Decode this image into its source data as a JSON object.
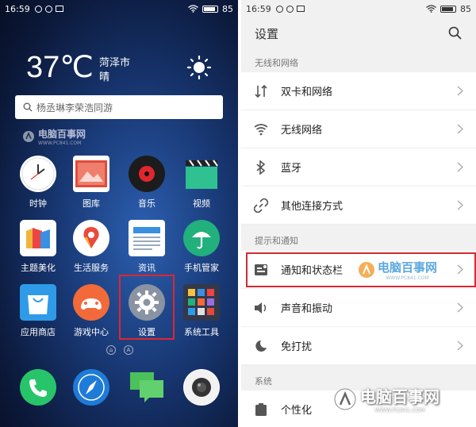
{
  "left": {
    "status": {
      "time": "16:59",
      "battery": "85"
    },
    "weather": {
      "temp": "37℃",
      "city": "菏泽市",
      "condition": "晴"
    },
    "search": {
      "hint": "杨丞琳李荣浩同游"
    },
    "watermark": {
      "title": "电脑百事网",
      "sub": "WWW.PC841.COM"
    },
    "apps": [
      {
        "label": "时钟",
        "icon": "clock-icon"
      },
      {
        "label": "图库",
        "icon": "gallery-icon"
      },
      {
        "label": "音乐",
        "icon": "music-icon"
      },
      {
        "label": "视频",
        "icon": "video-icon"
      },
      {
        "label": "主题美化",
        "icon": "theme-icon"
      },
      {
        "label": "生活服务",
        "icon": "life-service-icon"
      },
      {
        "label": "资讯",
        "icon": "news-icon"
      },
      {
        "label": "手机管家",
        "icon": "phone-manager-icon"
      },
      {
        "label": "应用商店",
        "icon": "app-store-icon"
      },
      {
        "label": "游戏中心",
        "icon": "game-center-icon"
      },
      {
        "label": "设置",
        "icon": "settings-icon"
      },
      {
        "label": "系统工具",
        "icon": "system-tools-icon"
      }
    ],
    "pager": {
      "page2": "A"
    },
    "dock": [
      "phone-icon",
      "browser-icon",
      "messages-icon",
      "camera-icon"
    ]
  },
  "right": {
    "status": {
      "time": "16:59",
      "battery": "85"
    },
    "header": {
      "title": "设置"
    },
    "sections": {
      "wireless": "无线和网络",
      "notify": "提示和通知",
      "system": "系统"
    },
    "items": [
      {
        "label": "双卡和网络",
        "icon": "dual-sim-icon"
      },
      {
        "label": "无线网络",
        "icon": "wifi-icon"
      },
      {
        "label": "蓝牙",
        "icon": "bluetooth-icon"
      },
      {
        "label": "其他连接方式",
        "icon": "link-icon"
      },
      {
        "label": "通知和状态栏",
        "icon": "notification-icon"
      },
      {
        "label": "声音和振动",
        "icon": "sound-icon"
      },
      {
        "label": "免打扰",
        "icon": "moon-icon"
      },
      {
        "label": "个性化",
        "icon": "personalize-icon"
      }
    ],
    "watermark_mid": {
      "title": "电脑百事网",
      "sub": "WWW.PC841.COM"
    },
    "watermark_big": {
      "title": "电脑百事网",
      "sub": "WWW.PC841.COM"
    }
  }
}
